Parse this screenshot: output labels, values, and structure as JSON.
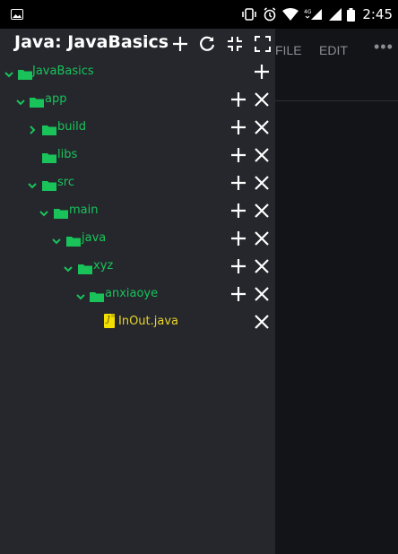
{
  "status_bar": {
    "time": "2:45",
    "network_label": "4G"
  },
  "editor": {
    "menu_file": "FILE",
    "menu_edit": "EDIT",
    "menu_more": "•••"
  },
  "drawer": {
    "title": "Java: JavaBasics",
    "header_icons": [
      "add-icon",
      "refresh-icon",
      "collapse-icon",
      "expand-icon"
    ]
  },
  "tree": [
    {
      "label": "JavaBasics",
      "type": "folder",
      "expanded": true
    },
    {
      "label": "app",
      "type": "folder",
      "expanded": true
    },
    {
      "label": "build",
      "type": "folder",
      "expanded": false
    },
    {
      "label": "libs",
      "type": "folder",
      "expanded": null
    },
    {
      "label": "src",
      "type": "folder",
      "expanded": true
    },
    {
      "label": "main",
      "type": "folder",
      "expanded": true
    },
    {
      "label": "java",
      "type": "folder",
      "expanded": true
    },
    {
      "label": "xyz",
      "type": "folder",
      "expanded": true
    },
    {
      "label": "anxiaoye",
      "type": "folder",
      "expanded": true
    },
    {
      "label": "InOut.java",
      "type": "file",
      "expanded": null
    }
  ],
  "colors": {
    "folder": "#19c35a",
    "file": "#e8d32a",
    "drawer_bg": "#25272d",
    "editor_bg": "#131417"
  }
}
